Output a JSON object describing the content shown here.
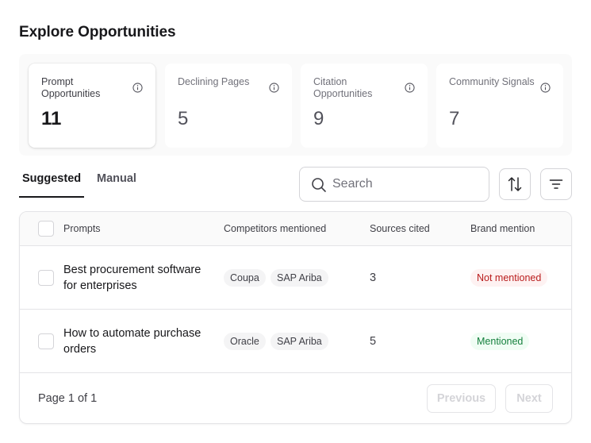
{
  "page": {
    "title": "Explore Opportunities"
  },
  "stats": [
    {
      "label": "Prompt Opportunities",
      "value": "11",
      "icon": "info-icon",
      "active": true
    },
    {
      "label": "Declining Pages",
      "value": "5",
      "icon": "info-icon",
      "active": false
    },
    {
      "label": "Citation Opportunities",
      "value": "9",
      "icon": "info-icon",
      "active": false
    },
    {
      "label": "Community Signals",
      "value": "7",
      "icon": "info-icon",
      "active": false
    }
  ],
  "tabs": [
    {
      "label": "Suggested",
      "active": true
    },
    {
      "label": "Manual",
      "active": false
    }
  ],
  "search": {
    "placeholder": "Search",
    "value": "",
    "icon": "search-icon"
  },
  "toolbar": {
    "sort_icon": "sort-arrows-icon",
    "filter_icon": "filter-icon"
  },
  "table": {
    "columns": [
      "Prompts",
      "Competitors mentioned",
      "Sources cited",
      "Brand mention"
    ],
    "rows": [
      {
        "prompt": "Best procurement software for enterprises",
        "competitors": [
          "Coupa",
          "SAP Ariba"
        ],
        "sources": "3",
        "brand_mention": "Not mentioned",
        "brand_status": "negative"
      },
      {
        "prompt": "How to automate purchase orders",
        "competitors": [
          "Oracle",
          "SAP Ariba"
        ],
        "sources": "5",
        "brand_mention": "Mentioned",
        "brand_status": "positive"
      }
    ]
  },
  "pagination": {
    "info": "Page 1 of 1",
    "previous_label": "Previous",
    "next_label": "Next"
  },
  "colors": {
    "negative_bg": "#fef2f2",
    "negative_text": "#b91c1c",
    "positive_bg": "#f0fdf4",
    "positive_text": "#15803d"
  }
}
